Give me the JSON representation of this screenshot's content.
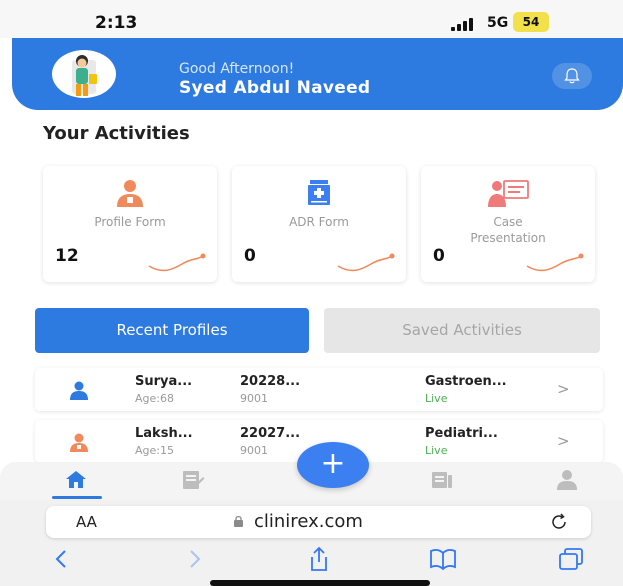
{
  "status_bar": {
    "time": "2:13",
    "network": "5G",
    "battery": "54"
  },
  "header": {
    "greeting": "Good Afternoon!",
    "user_name": "Syed Abdul Naveed"
  },
  "activities": {
    "title": "Your Activities",
    "cards": [
      {
        "label": "Profile Form",
        "count": "12",
        "icon": "doctor-icon",
        "accent": "#f08a5d"
      },
      {
        "label": "ADR Form",
        "count": "0",
        "icon": "medicine-cabinet-icon",
        "accent": "#3c7ff0"
      },
      {
        "label": "Case\nPresentation",
        "count": "0",
        "icon": "presentation-icon",
        "accent": "#f07a7a"
      }
    ]
  },
  "tabs": {
    "active": "Recent Profiles",
    "inactive": "Saved Activities"
  },
  "profiles": [
    {
      "name": "Surya...",
      "age": "Age:68",
      "id": "20228...",
      "id_sub": "9001",
      "dept": "Gastroen...",
      "status": "Live",
      "icon_color": "#2d7ae0"
    },
    {
      "name": "Laksh...",
      "age": "Age:15",
      "id": "22027...",
      "id_sub": "9001",
      "dept": "Pediatri...",
      "status": "Live",
      "icon_color": "#f08a5d"
    }
  ],
  "row_chevron": ">",
  "bottom_nav": {
    "items": [
      "home-icon",
      "form-icon",
      "add-icon",
      "report-icon",
      "profile-icon"
    ],
    "fab": "+"
  },
  "browser": {
    "aa": "AA",
    "url": "clinirex.com"
  },
  "colors": {
    "primary": "#2d7ae0",
    "live": "#4caf50"
  }
}
